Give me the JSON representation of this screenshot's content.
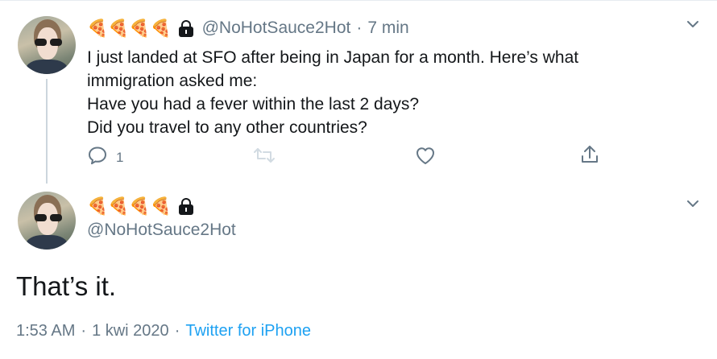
{
  "reply_tweet": {
    "author_emoji": "🍕🍕🍕🍕",
    "handle": "@NoHotSauce2Hot",
    "separator": "·",
    "time": "7 min",
    "text_lines": [
      "I just landed at SFO after being in Japan for a month. Here’s what",
      "immigration asked me:",
      "Have you had a fever within the last 2 days?",
      "Did you travel to any other countries?"
    ],
    "reply_count": "1",
    "retweet_count": "",
    "like_count": "",
    "icons": [
      "reply-icon",
      "retweet-icon",
      "like-icon",
      "share-icon",
      "lock-icon",
      "chevron-down-icon"
    ]
  },
  "main_tweet": {
    "author_emoji": "🍕🍕🍕🍕",
    "handle": "@NoHotSauce2Hot",
    "text": "That’s it.",
    "time": "1:53 AM",
    "separator": "·",
    "date": "1 kwi 2020",
    "source": "Twitter for iPhone"
  },
  "colors": {
    "text": "#14171a",
    "secondary": "#657786",
    "link": "#1da1f2",
    "thread_line": "#ccd6dd"
  }
}
